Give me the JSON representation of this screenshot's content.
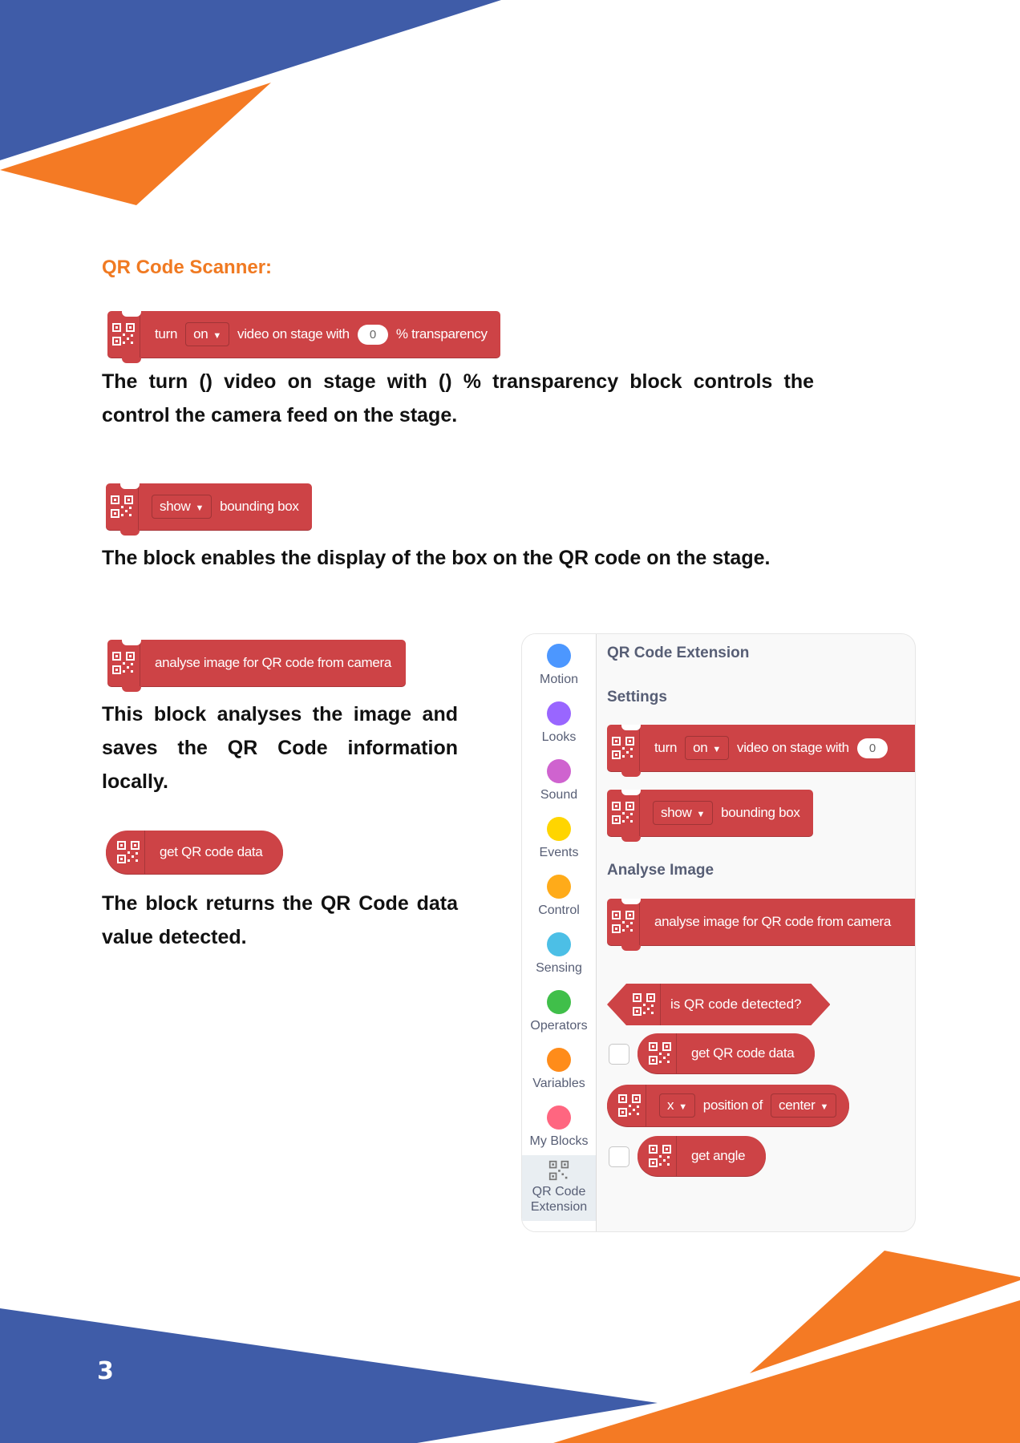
{
  "heading": "QR Code Scanner:",
  "block_turn": {
    "turn": "turn",
    "on": "on",
    "video": "video on stage with",
    "value": "0",
    "transparency": "% transparency"
  },
  "para1": "The turn () video on stage with () % transparency block controls the control the camera feed on the stage.",
  "block_show": {
    "show": "show",
    "bbox": "bounding box"
  },
  "para2": "The block enables the display of the box on the QR code on the stage.",
  "block_analyse": {
    "label": "analyse image for QR code from camera"
  },
  "para3": "This block analyses the image and saves the QR Code information locally.",
  "block_get": {
    "label": "get QR code data"
  },
  "para4": "The block returns the QR Code data value detected.",
  "palette": {
    "title": "QR Code Extension",
    "settings": "Settings",
    "analyse_image": "Analyse Image",
    "turn": "turn",
    "on": "on",
    "video": "video on stage with",
    "value": "0",
    "show": "show",
    "bbox": "bounding box",
    "analyse": "analyse image for QR code from camera",
    "detected": "is QR code detected?",
    "get_data": "get QR code data",
    "x": "x",
    "position_of": "position of",
    "center": "center",
    "get_angle": "get angle",
    "categories": [
      {
        "label": "Motion",
        "color": "#4c97ff"
      },
      {
        "label": "Looks",
        "color": "#9966ff"
      },
      {
        "label": "Sound",
        "color": "#cf63cf"
      },
      {
        "label": "Events",
        "color": "#ffd500"
      },
      {
        "label": "Control",
        "color": "#ffab19"
      },
      {
        "label": "Sensing",
        "color": "#4cbfe6"
      },
      {
        "label": "Operators",
        "color": "#40bf4a"
      },
      {
        "label": "Variables",
        "color": "#ff8c1a"
      },
      {
        "label": "My Blocks",
        "color": "#ff6680"
      }
    ],
    "selected_category": "QR Code Extension"
  },
  "page_number": "3",
  "colors": {
    "blue": "#3f5ca8",
    "orange": "#f47a24",
    "block": "#cd4346"
  }
}
